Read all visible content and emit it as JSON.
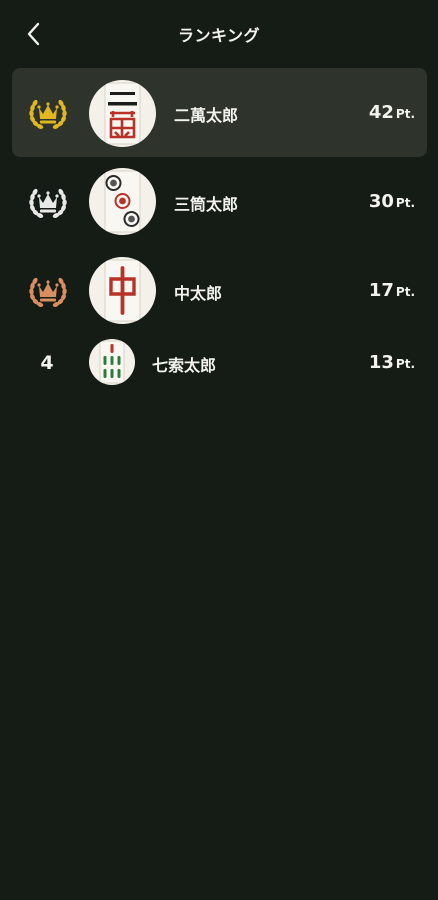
{
  "header": {
    "title": "ランキング"
  },
  "colors": {
    "background": "#151c15",
    "highlight_row": "#2e332b",
    "gold": "#e0b720",
    "silver": "#e8e8e8",
    "bronze": "#d98e62",
    "tile_red": "#b8322a"
  },
  "rankings": [
    {
      "rank": "1",
      "badge_icon": "gold-crown-laurel-icon",
      "avatar_icon": "mahjong-2-man-tile-icon",
      "name": "二萬太郎",
      "score": "42",
      "unit": "Pt."
    },
    {
      "rank": "2",
      "badge_icon": "silver-crown-laurel-icon",
      "avatar_icon": "mahjong-3-pin-tile-icon",
      "name": "三筒太郎",
      "score": "30",
      "unit": "Pt."
    },
    {
      "rank": "3",
      "badge_icon": "bronze-crown-laurel-icon",
      "avatar_icon": "mahjong-chun-tile-icon",
      "name": "中太郎",
      "score": "17",
      "unit": "Pt."
    },
    {
      "rank": "4",
      "badge_icon": "",
      "avatar_icon": "mahjong-7-sou-tile-icon",
      "name": "七索太郎",
      "score": "13",
      "unit": "Pt."
    }
  ]
}
